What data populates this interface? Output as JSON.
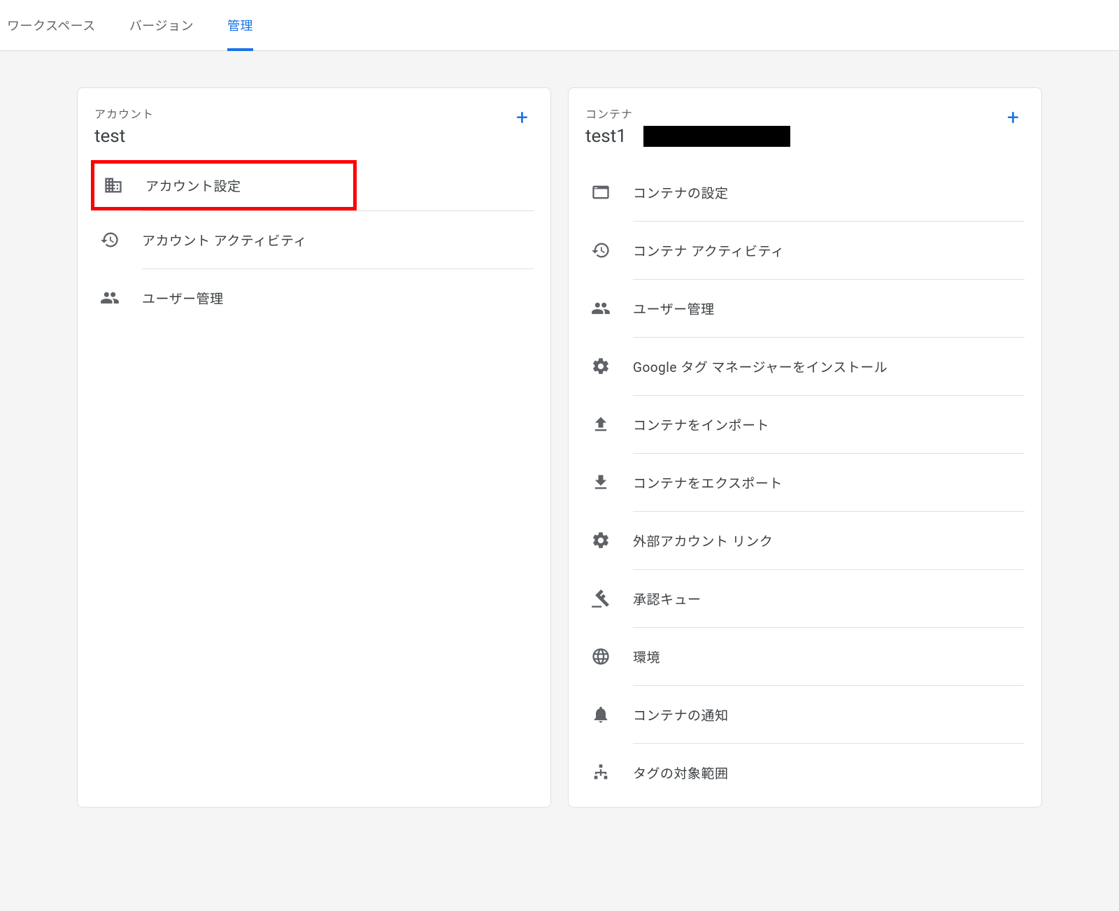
{
  "tabs": {
    "workspace": "ワークスペース",
    "version": "バージョン",
    "admin": "管理"
  },
  "account_card": {
    "label": "アカウント",
    "title": "test",
    "items": {
      "settings": "アカウント設定",
      "activity": "アカウント アクティビティ",
      "user_mgmt": "ユーザー管理"
    }
  },
  "container_card": {
    "label": "コンテナ",
    "title": "test1",
    "items": {
      "settings": "コンテナの設定",
      "activity": "コンテナ アクティビティ",
      "user_mgmt": "ユーザー管理",
      "install": "Google タグ マネージャーをインストール",
      "import": "コンテナをインポート",
      "export": "コンテナをエクスポート",
      "external": "外部アカウント リンク",
      "approval": "承認キュー",
      "env": "環境",
      "notify": "コンテナの通知",
      "scope": "タグの対象範囲"
    }
  }
}
